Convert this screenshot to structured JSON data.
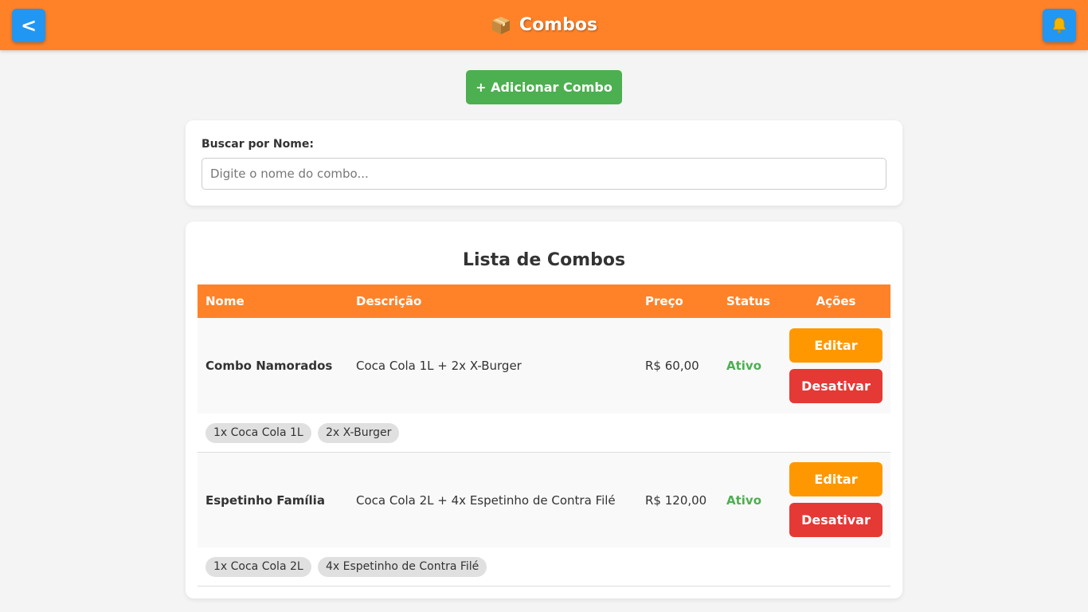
{
  "header": {
    "back_label": "<",
    "title": "Combos",
    "title_icon": "package-icon",
    "bell_icon": "bell-icon",
    "color": "#ff8228"
  },
  "add_button": {
    "label": "+ Adicionar Combo",
    "color": "#4caf50"
  },
  "search": {
    "label": "Buscar por Nome:",
    "placeholder": "Digite o nome do combo...",
    "value": ""
  },
  "list": {
    "title": "Lista de Combos",
    "columns": [
      "Nome",
      "Descrição",
      "Preço",
      "Status",
      "Ações"
    ],
    "rows": [
      {
        "name": "Combo Namorados",
        "description": "Coca Cola 1L + 2x X-Burger",
        "price": "R$ 60,00",
        "status": "Ativo",
        "edit_label": "Editar",
        "deactivate_label": "Desativar",
        "items": [
          "1x Coca Cola 1L",
          "2x X-Burger"
        ]
      },
      {
        "name": "Espetinho Família",
        "description": "Coca Cola 2L + 4x Espetinho de Contra Filé",
        "price": "R$ 120,00",
        "status": "Ativo",
        "edit_label": "Editar",
        "deactivate_label": "Desativar",
        "items": [
          "1x Coca Cola 2L",
          "4x Espetinho de Contra Filé"
        ]
      }
    ]
  }
}
